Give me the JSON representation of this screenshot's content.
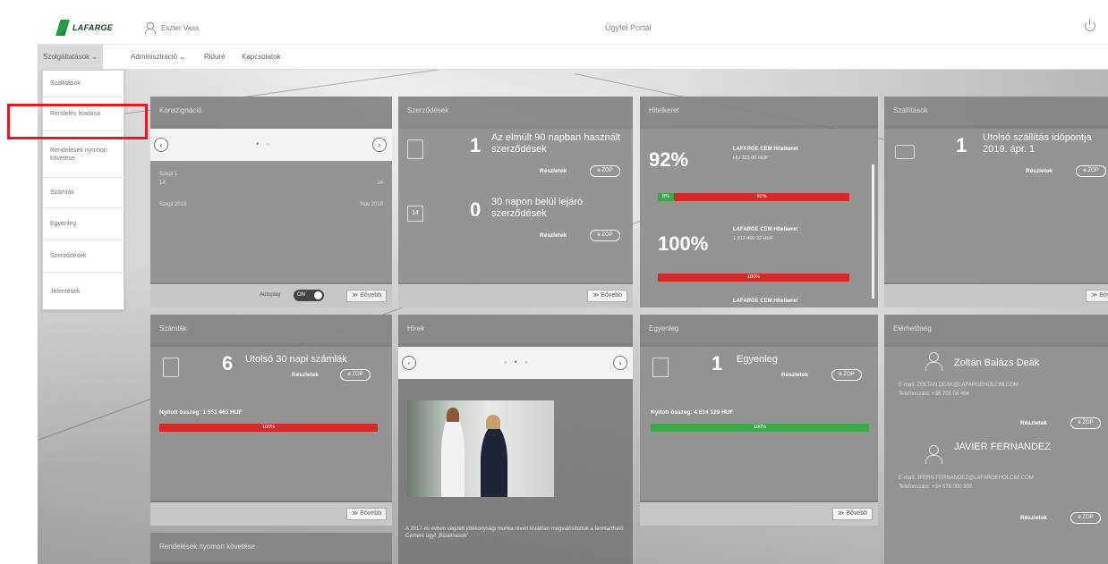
{
  "header": {
    "logo_text": "LAFARGE",
    "user_name": "Eszter Vass",
    "portal_title": "Ügyfél Portál"
  },
  "nav": {
    "items": [
      {
        "label": "Szolgáltatások ⌄"
      },
      {
        "label": "Adminisztráció ⌄"
      },
      {
        "label": "Riduré"
      },
      {
        "label": "Kapcsolatok"
      }
    ]
  },
  "dropdown": {
    "items": [
      {
        "label": "Szállítások"
      },
      {
        "label": "Rendelés leadása"
      },
      {
        "label": "Rendelések nyomon követése"
      },
      {
        "label": "Számlák"
      },
      {
        "label": "Egyenleg"
      },
      {
        "label": "Szerződések"
      },
      {
        "label": "Jelentések"
      }
    ]
  },
  "cards": {
    "konszignacio": {
      "title": "Konszignáció",
      "row1_left": "Szept 1",
      "row1_right": "14",
      "row1_sub": "14",
      "row2_left": "Szept 2019",
      "row2_right": "Nov 2019",
      "autoplay_label": "Autoplay",
      "toggle_label": "ON",
      "more": "≫ Bővebb"
    },
    "szerzodesek": {
      "title": "Szerződések",
      "count1": "1",
      "text1": "Az elmúlt 90 napban használt szerződések",
      "count2": "0",
      "text2": "30 napon belül lejáró szerződések",
      "cal_day": "14",
      "details": "Részletek",
      "pill": "ɵ ZOP",
      "more": "≫ Bővebb"
    },
    "hitelkeret": {
      "title": "Hitelkeret",
      "pct1": "92%",
      "name1": "LAFARGE CEM Hitelkeret",
      "sub1": "HU 223 00 HUF",
      "bar1_left": "8%",
      "bar1_main": "92%",
      "pct2": "100%",
      "name2": "LAFARGE CEM Hitelkeret",
      "sub2": "1 213 400 32 HUF",
      "bar2_main": "100%",
      "cut_text": "LAFARGE CEM Hitelkeret"
    },
    "szallitasok": {
      "title": "Szállítások",
      "count": "1",
      "text": "Utolsó szállítás időpontja 2019. ápr. 1",
      "details": "Részletek",
      "pill": "ɵ ZOP",
      "more": "≫ Bővebb"
    },
    "szamlak": {
      "title": "Számlák",
      "count": "6",
      "text": "Utolsó 30 napi számlák",
      "details": "Részletek",
      "pill": "ɵ ZOP",
      "open_label": "Nyitott összeg: 1 551 465 HUF",
      "bar": "100%",
      "more": "≫ Bővebb"
    },
    "hirek": {
      "title": "Hírek",
      "caption": "A 2017-es évben végzett jótékonysági munka révén kiválóan megvalósítottuk a fenntartható Cement ügyf „Bizalmasok”"
    },
    "egyenleg": {
      "title": "Egyenleg",
      "count": "1",
      "text": "Egyenleg",
      "details": "Részletek",
      "pill": "ɵ ZOP",
      "open_label": "Nyitott összeg: 4 614 129 HUF",
      "bar": "100%",
      "more": "≫ Bővebb"
    },
    "elerhetoseg": {
      "title": "Elérhetőség",
      "person1": "Zoltán Balázs Deák",
      "person1_email": "E-mail: ZOLTAN.DEAK@LAFARGEHOLCIM.COM",
      "person1_phone": "Telefonszám: +36 705 06 464",
      "details": "Részletek",
      "pill": "ɵ ZOP",
      "person2": "JAVIER FERNANDEZ",
      "person2_email": "E-mail: JFERN.FERNANDEZ@LAFARGEHOLCIM.COM",
      "person2_phone": "Telefonszám: +34 679 000 000"
    },
    "rendelesek": {
      "title": "Rendelések nyomon követése"
    }
  },
  "colors": {
    "red_bar": "#d42a2a",
    "green_bar": "#3da84a",
    "highlight": "#e31b23",
    "logo_green": "#1a8a3a"
  },
  "progress": {
    "credit1_fraction": 0.92,
    "credit2_fraction": 1.0,
    "invoices_fraction": 1.0,
    "balance_fraction": 1.0
  }
}
